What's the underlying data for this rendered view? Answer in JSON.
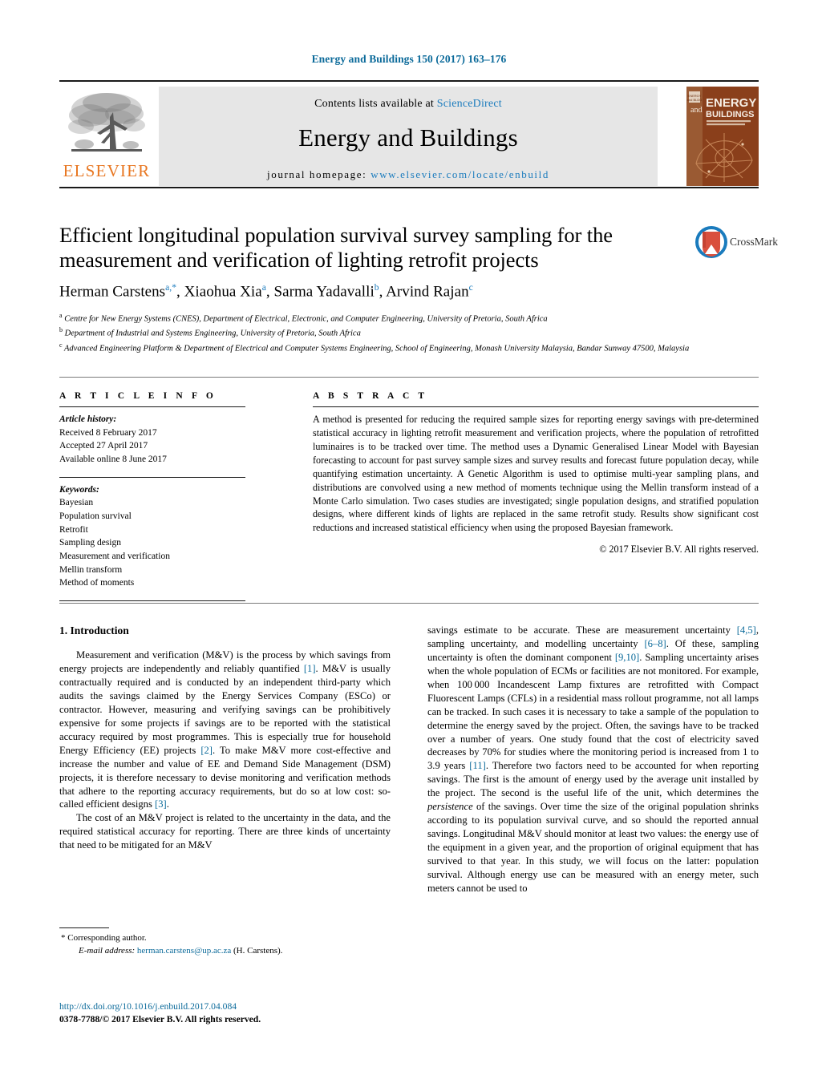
{
  "running_head": "Energy and Buildings 150 (2017) 163–176",
  "masthead": {
    "contents_prefix": "Contents lists available at ",
    "sciencedirect": "ScienceDirect",
    "journal_title": "Energy and Buildings",
    "homepage_prefix": "journal homepage: ",
    "homepage_url": "www.elsevier.com/locate/enbuild",
    "publisher_logo_text": "ELSEVIER",
    "cover_line1": "and",
    "cover_line2": "ENERGY",
    "cover_line3": "BUILDINGS",
    "accent_color": "#1a7bbd",
    "elsevier_orange": "#E87722"
  },
  "article": {
    "title": "Efficient longitudinal population survival survey sampling for the measurement and verification of lighting retrofit projects",
    "authors_html": "Herman Carstens<sup>a,*</sup>, Xiaohua Xia<sup>a</sup>, Sarma Yadavalli<sup>b</sup>, Arvind Rajan<sup>c</sup>",
    "crossmark_label": "CrossMark",
    "affiliations": [
      "Centre for New Energy Systems (CNES), Department of Electrical, Electronic, and Computer Engineering, University of Pretoria, South Africa",
      "Department of Industrial and Systems Engineering, University of Pretoria, South Africa",
      "Advanced Engineering Platform & Department of Electrical and Computer Systems Engineering, School of Engineering, Monash University Malaysia, Bandar Sunway 47500, Malaysia"
    ],
    "affiliation_marks": [
      "a",
      "b",
      "c"
    ]
  },
  "article_info": {
    "heading": "A R T I C L E   I N F O",
    "history_label": "Article history:",
    "history": [
      "Received 8 February 2017",
      "Accepted 27 April 2017",
      "Available online 8 June 2017"
    ],
    "keywords_label": "Keywords:",
    "keywords": [
      "Bayesian",
      "Population survival",
      "Retrofit",
      "Sampling design",
      "Measurement and verification",
      "Mellin transform",
      "Method of moments"
    ]
  },
  "abstract": {
    "heading": "A B S T R A C T",
    "text": "A method is presented for reducing the required sample sizes for reporting energy savings with pre-determined statistical accuracy in lighting retrofit measurement and verification projects, where the population of retrofitted luminaires is to be tracked over time. The method uses a Dynamic Generalised Linear Model with Bayesian forecasting to account for past survey sample sizes and survey results and forecast future population decay, while quantifying estimation uncertainty. A Genetic Algorithm is used to optimise multi-year sampling plans, and distributions are convolved using a new method of moments technique using the Mellin transform instead of a Monte Carlo simulation. Two cases studies are investigated; single population designs, and stratified population designs, where different kinds of lights are replaced in the same retrofit study. Results show significant cost reductions and increased statistical efficiency when using the proposed Bayesian framework.",
    "copyright": "© 2017 Elsevier B.V. All rights reserved."
  },
  "body": {
    "section_number_title": "1.  Introduction",
    "left_paragraphs": [
      "Measurement and verification (M&V) is the process by which savings from energy projects are independently and reliably quantified [1]. M&V is usually contractually required and is conducted by an independent third-party which audits the savings claimed by the Energy Services Company (ESCo) or contractor. However, measuring and verifying savings can be prohibitively expensive for some projects if savings are to be reported with the statistical accuracy required by most programmes. This is especially true for household Energy Efficiency (EE) projects [2]. To make M&V more cost-effective and increase the number and value of EE and Demand Side Management (DSM) projects, it is therefore necessary to devise monitoring and verification methods that adhere to the reporting accuracy requirements, but do so at low cost: so-called efficient designs [3].",
      "The cost of an M&V project is related to the uncertainty in the data, and the required statistical accuracy for reporting. There are three kinds of uncertainty that need to be mitigated for an M&V"
    ],
    "right_paragraphs": [
      "savings estimate to be accurate. These are measurement uncertainty [4,5], sampling uncertainty, and modelling uncertainty [6–8]. Of these, sampling uncertainty is often the dominant component [9,10]. Sampling uncertainty arises when the whole population of ECMs or facilities are not monitored. For example, when 100 000 Incandescent Lamp fixtures are retrofitted with Compact Fluorescent Lamps (CFLs) in a residential mass rollout programme, not all lamps can be tracked. In such cases it is necessary to take a sample of the population to determine the energy saved by the project. Often, the savings have to be tracked over a number of years. One study found that the cost of electricity saved decreases by 70% for studies where the monitoring period is increased from 1 to 3.9 years [11]. Therefore two factors need to be accounted for when reporting savings. The first is the amount of energy used by the average unit installed by the project. The second is the useful life of the unit, which determines the persistence of the savings. Over time the size of the original population shrinks according to its population survival curve, and so should the reported annual savings. Longitudinal M&V should monitor at least two values: the energy use of the equipment in a given year, and the proportion of original equipment that has survived to that year. In this study, we will focus on the latter: population survival. Although energy use can be measured with an energy meter, such meters cannot be used to"
    ],
    "citations_left": [
      "[1]",
      "[2]",
      "[3]"
    ],
    "citations_right": [
      "[4,5]",
      "[6–8]",
      "[9,10]",
      "[11]"
    ]
  },
  "footnote": {
    "corresponding": "*  Corresponding author.",
    "email_label": "E-mail address:",
    "email": "herman.carstens@up.ac.za",
    "email_suffix": "(H. Carstens)."
  },
  "footer": {
    "doi": "http://dx.doi.org/10.1016/j.enbuild.2017.04.084",
    "issn_line": "0378-7788/© 2017 Elsevier B.V. All rights reserved."
  }
}
